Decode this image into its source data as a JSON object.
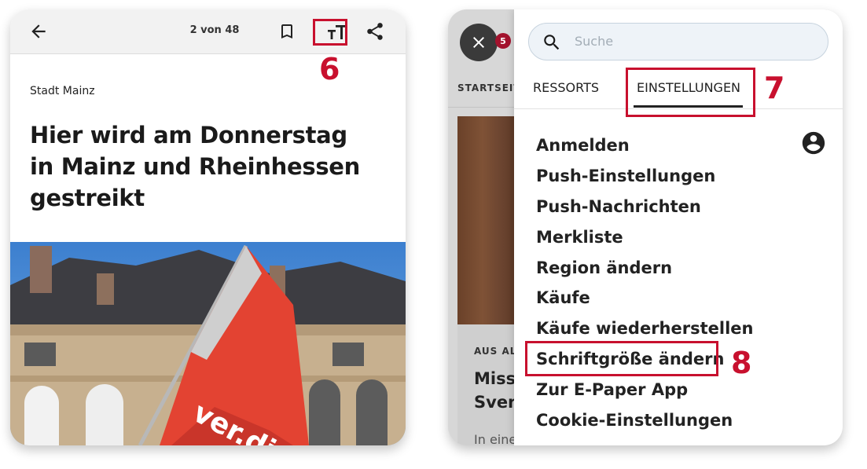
{
  "article_view": {
    "toolbar": {
      "back_icon": "arrow-left-icon",
      "page_counter": "2 von 48",
      "bookmark_icon": "bookmark-icon",
      "font_size_icon": "font-size-icon",
      "share_icon": "share-icon"
    },
    "dateline": "Stadt Mainz",
    "headline": "Hier wird am Donnerstag in Mainz und Rheinhessen gestreikt",
    "photo_flag_text": "ver.di"
  },
  "callouts": {
    "step_6": "6",
    "step_7": "7",
    "step_8": "8",
    "highlight_color": "#c8102e"
  },
  "menu_view": {
    "background": {
      "tab_label": "STARTSEITE",
      "kicker": "AUS AL",
      "title_line_1": "Missb",
      "title_line_2": "Sven",
      "teaser": "In eine"
    },
    "close_icon": "close-icon",
    "notification_count": "5",
    "search": {
      "placeholder": "Suche",
      "icon": "search-icon"
    },
    "tabs": [
      {
        "label": "RESSORTS",
        "active": false
      },
      {
        "label": "EINSTELLUNGEN",
        "active": true
      }
    ],
    "account_icon": "account-circle-icon",
    "menu_items": [
      "Anmelden",
      "Push-Einstellungen",
      "Push-Nachrichten",
      "Merkliste",
      "Region ändern",
      "Käufe",
      "Käufe wiederherstellen",
      "Schriftgröße ändern",
      "Zur E-Paper App",
      "Cookie-Einstellungen"
    ]
  },
  "colors": {
    "brand_red": "#a3122d",
    "toolbar_bg": "#f2f2f2",
    "search_bg": "#eef3f8",
    "text_dark": "#222222"
  }
}
